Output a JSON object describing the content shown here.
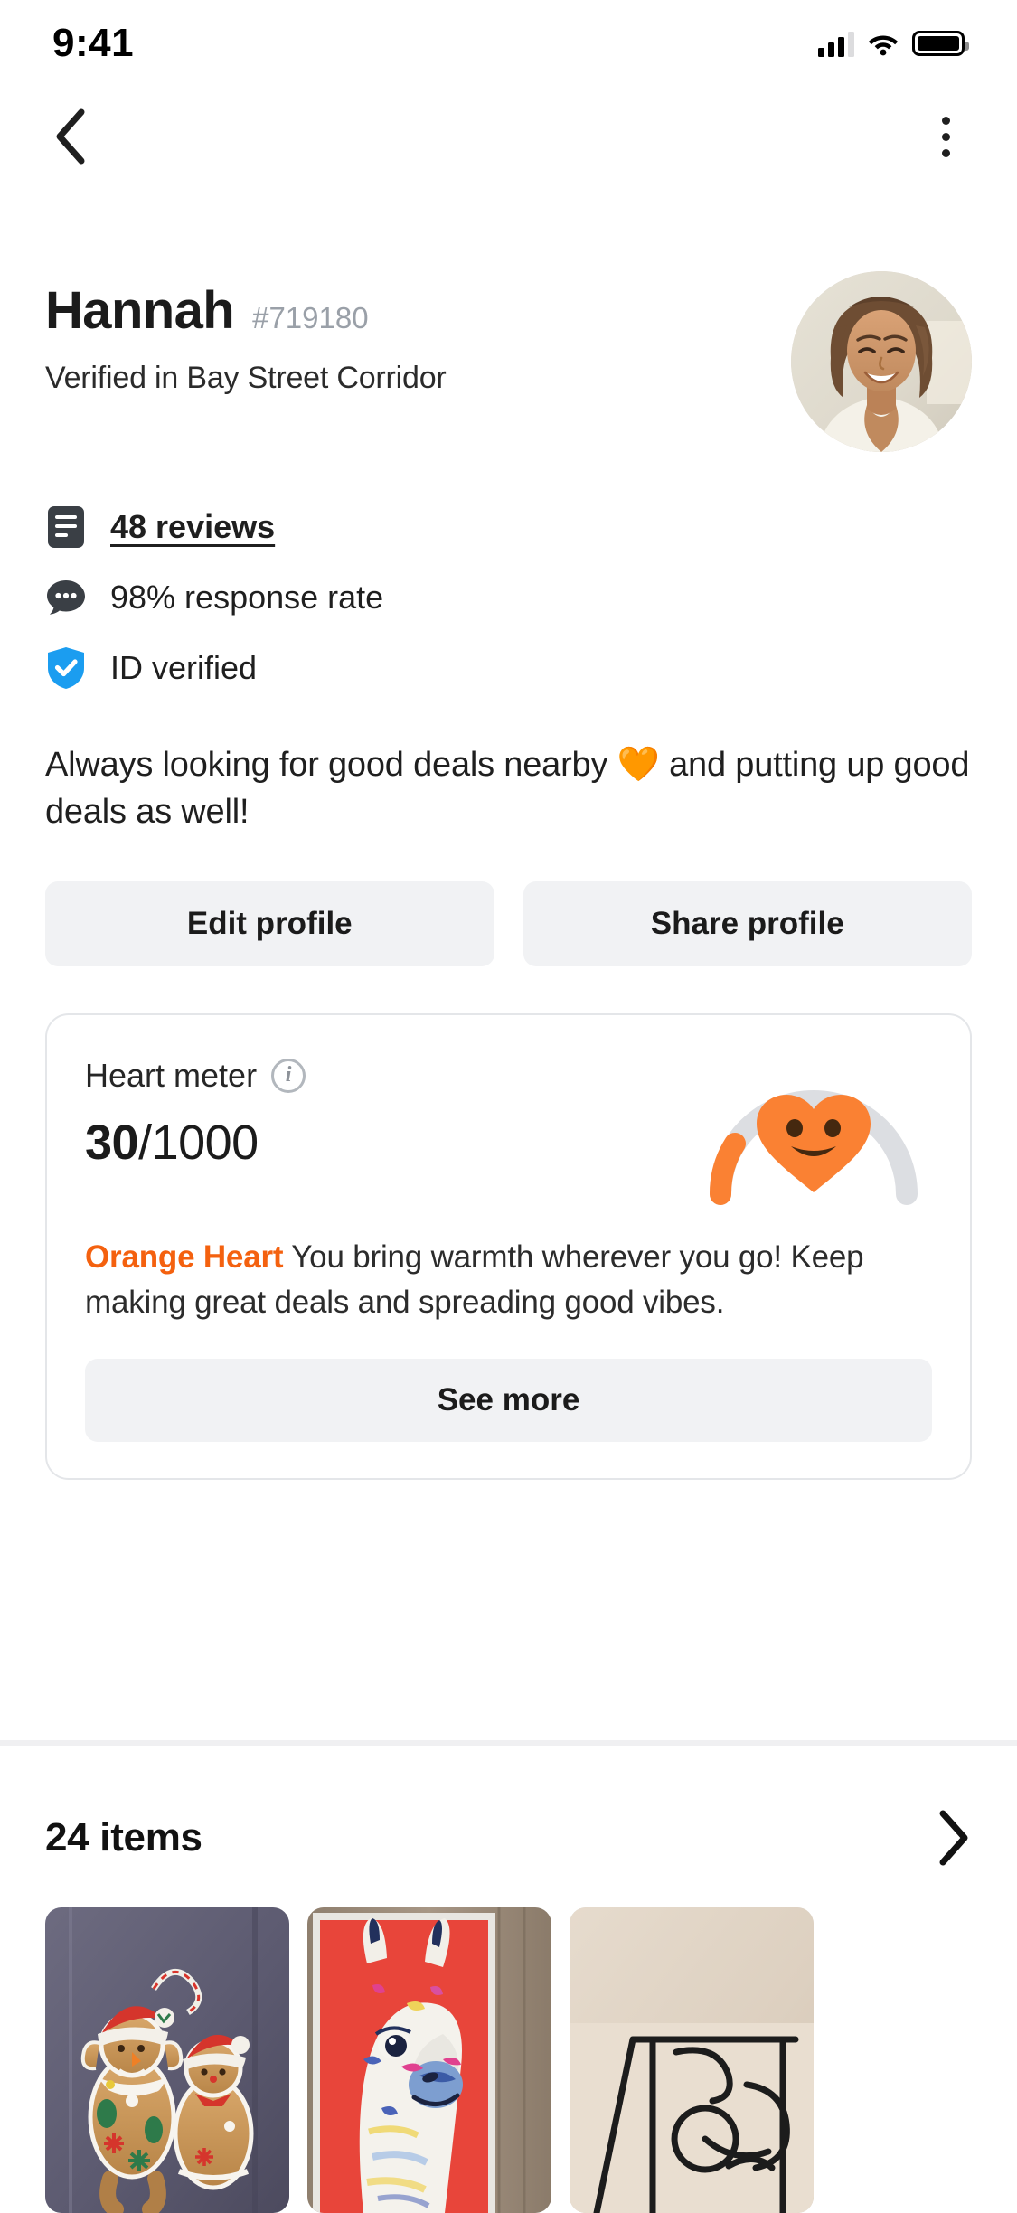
{
  "status_bar": {
    "time": "9:41",
    "signal_icon": "cellular-signal-icon",
    "wifi_icon": "wifi-icon",
    "battery_icon": "battery-icon"
  },
  "nav": {
    "back_icon": "back-chevron-icon",
    "menu_icon": "overflow-menu-icon"
  },
  "profile": {
    "name": "Hannah",
    "handle": "#719180",
    "verified_location": "Verified in Bay Street Corridor",
    "avatar_alt": "profile-photo",
    "bio": "Always looking for good deals nearby 🧡 and putting up good deals as well!",
    "stats": [
      {
        "icon": "reviews-icon",
        "label": "48 reviews",
        "is_link": true
      },
      {
        "icon": "chat-bubble-icon",
        "label": "98% response rate",
        "is_link": false
      },
      {
        "icon": "id-verified-shield-icon",
        "label": "ID verified",
        "is_link": false
      }
    ]
  },
  "actions": {
    "edit_profile": "Edit profile",
    "share_profile": "Share profile"
  },
  "heart_meter": {
    "title": "Heart meter",
    "info_icon": "info-circle-icon",
    "score": "30",
    "score_max": "/1000",
    "gauge_icon": "heart-gauge-icon",
    "tier": "Orange Heart",
    "description": "You bring warmth wherever you go! Keep making great deals and spreading good vibes.",
    "see_more": "See more",
    "progress_percent": 3,
    "accent_color": "#f4610f",
    "track_color": "#dcdee2"
  },
  "items_section": {
    "title": "24 items",
    "chevron_icon": "right-chevron-icon",
    "thumbnails": [
      {
        "name": "gingerbread-ornaments-thumbnail"
      },
      {
        "name": "llama-painting-thumbnail"
      },
      {
        "name": "wire-face-art-thumbnail"
      }
    ]
  },
  "colors": {
    "verified_blue": "#1b9df0",
    "orange": "#f4610f",
    "button_gray": "#f1f2f4",
    "text_dark": "#1b1b1b"
  }
}
